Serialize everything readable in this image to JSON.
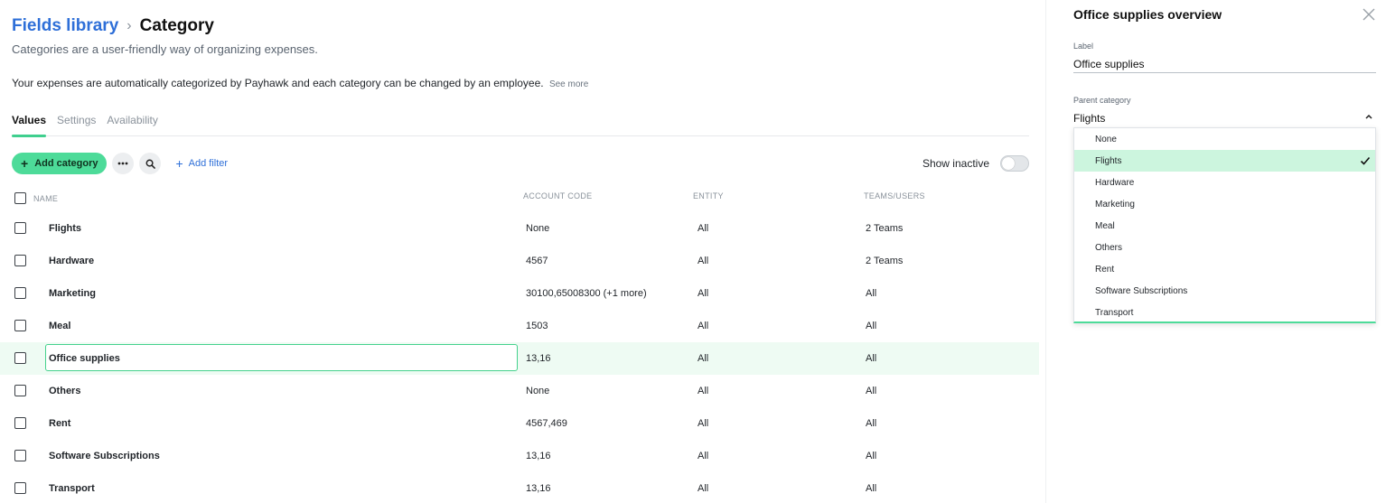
{
  "breadcrumb": {
    "parent": "Fields library",
    "current": "Category"
  },
  "subtitle": "Categories are a user-friendly way of organizing expenses.",
  "description": {
    "text": "Your expenses are automatically categorized by Payhawk and each category can be changed by an employee.",
    "see_more": "See more"
  },
  "tabs": [
    {
      "label": "Values",
      "active": true
    },
    {
      "label": "Settings",
      "active": false
    },
    {
      "label": "Availability",
      "active": false
    }
  ],
  "toolbar": {
    "add_label": "Add category",
    "add_filter_label": "Add filter",
    "show_inactive_label": "Show inactive",
    "show_inactive_on": false
  },
  "columns": {
    "name": "NAME",
    "account_code": "ACCOUNT CODE",
    "entity": "ENTITY",
    "teams": "TEAMS/USERS"
  },
  "rows": [
    {
      "name": "Flights",
      "account_code": "None",
      "entity": "All",
      "teams": "2 Teams"
    },
    {
      "name": "Hardware",
      "account_code": "4567",
      "entity": "All",
      "teams": "2 Teams"
    },
    {
      "name": "Marketing",
      "account_code": "30100,65008300 (+1 more)",
      "entity": "All",
      "teams": "All"
    },
    {
      "name": "Meal",
      "account_code": "1503",
      "entity": "All",
      "teams": "All"
    },
    {
      "name": "Office supplies",
      "account_code": "13,16",
      "entity": "All",
      "teams": "All"
    },
    {
      "name": "Others",
      "account_code": "None",
      "entity": "All",
      "teams": "All"
    },
    {
      "name": "Rent",
      "account_code": "4567,469",
      "entity": "All",
      "teams": "All"
    },
    {
      "name": "Software Subscriptions",
      "account_code": "13,16",
      "entity": "All",
      "teams": "All"
    },
    {
      "name": "Transport",
      "account_code": "13,16",
      "entity": "All",
      "teams": "All"
    }
  ],
  "panel": {
    "title": "Office supplies overview",
    "label_caption": "Label",
    "label_value": "Office supplies",
    "parent_caption": "Parent category",
    "parent_value": "Flights",
    "options": [
      "None",
      "Flights",
      "Hardware",
      "Marketing",
      "Meal",
      "Others",
      "Rent",
      "Software Subscriptions",
      "Transport"
    ],
    "selected_option": "Flights"
  },
  "colors": {
    "accent": "#4ddb99",
    "link": "#2e6fd8",
    "selected_row": "#eefbf3",
    "selected_option": "#ccf5de"
  }
}
